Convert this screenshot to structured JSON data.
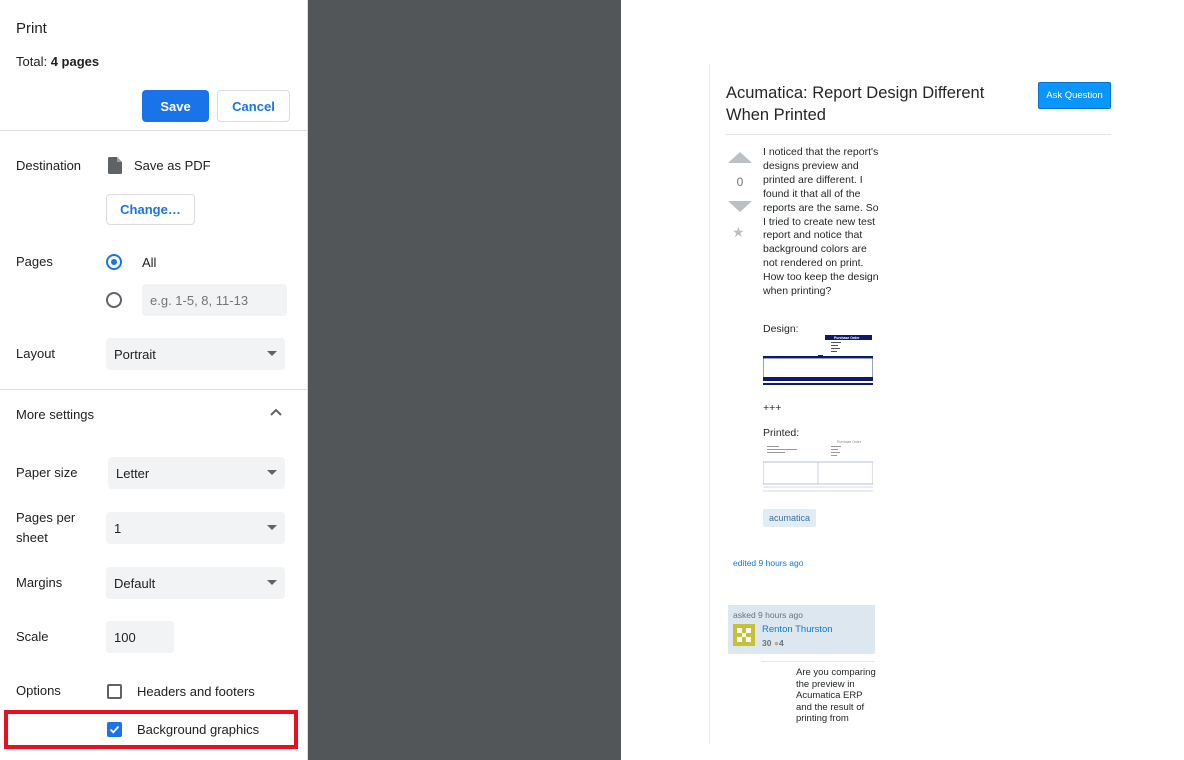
{
  "panel": {
    "title": "Print",
    "total_prefix": "Total: ",
    "total_value": "4 pages",
    "save_label": "Save",
    "cancel_label": "Cancel",
    "destination_label": "Destination",
    "destination_value": "Save as PDF",
    "change_label": "Change…",
    "pages_label": "Pages",
    "pages_all_label": "All",
    "pages_custom_placeholder": "e.g. 1-5, 8, 11-13",
    "layout_label": "Layout",
    "layout_value": "Portrait",
    "more_settings_label": "More settings",
    "paper_size_label": "Paper size",
    "paper_size_value": "Letter",
    "pages_per_sheet_label_1": "Pages per",
    "pages_per_sheet_label_2": "sheet",
    "pages_per_sheet_value": "1",
    "margins_label": "Margins",
    "margins_value": "Default",
    "scale_label": "Scale",
    "scale_value": "100",
    "options_label": "Options",
    "headers_footers_label": "Headers and footers",
    "headers_footers_checked": false,
    "background_graphics_label": "Background graphics",
    "background_graphics_checked": true
  },
  "preview": {
    "question_title": "Acumatica: Report Design Different When Printed",
    "ask_button": "Ask Question",
    "vote_count": "0",
    "body": "I noticed that the report's designs preview and printed are different. I found it that all of the reports are the same. So I tried to create new test report and notice that background colors are not rendered on print. How too keep the design when printing?",
    "design_label": "Design:",
    "separator": "+++",
    "printed_label": "Printed:",
    "thumb_heading": "Purchase Order",
    "tag": "acumatica",
    "edited": "edited 9 hours ago",
    "asked": "asked 9 hours ago",
    "user_name": "Renton Thurston",
    "reputation": "30",
    "bronze_badges": "4",
    "comment": "Are you comparing the preview in Acumatica ERP and the result of printing from"
  },
  "colors": {
    "accent": "#1a73e8",
    "highlight": "#e8101e",
    "preview_bg": "#525659",
    "report_navy": "#0b1a6e"
  }
}
